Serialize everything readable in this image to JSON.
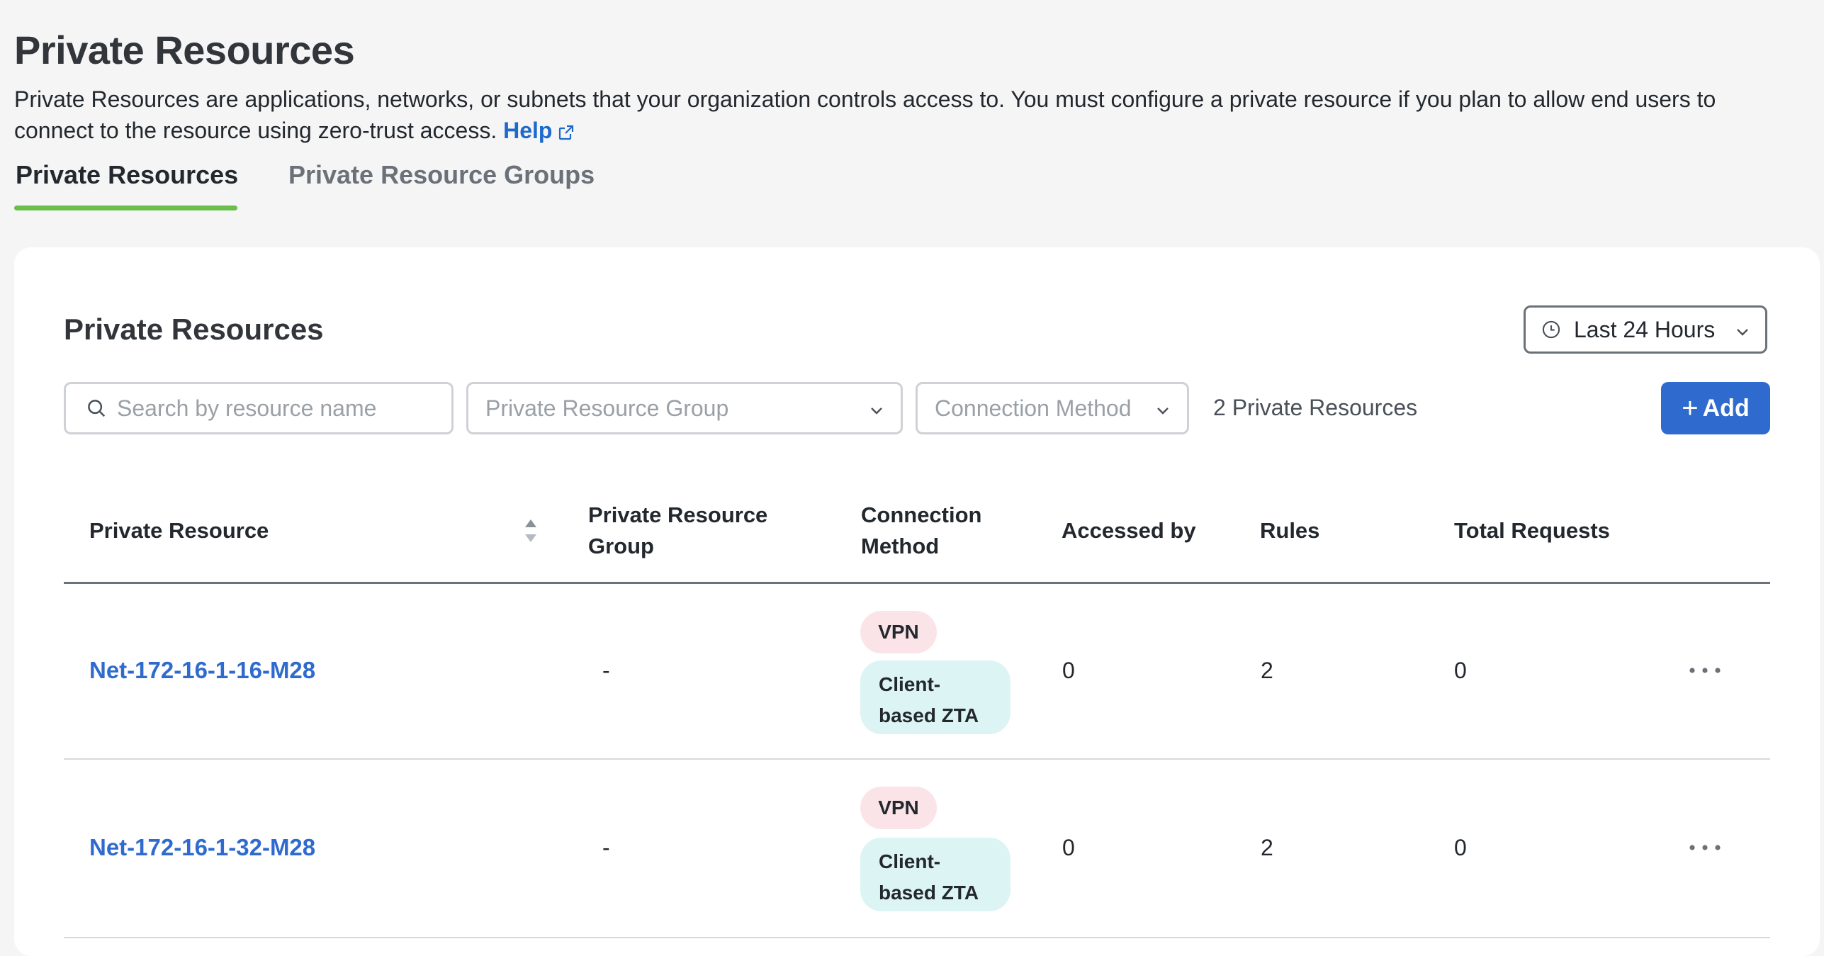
{
  "page": {
    "title": "Private Resources",
    "description": "Private Resources are applications, networks, or subnets that your organization controls access to. You must configure a private resource if you plan to allow end users to connect to the resource using zero-trust access.",
    "help_label": "Help"
  },
  "tabs": [
    {
      "label": "Private Resources",
      "active": true
    },
    {
      "label": "Private Resource Groups",
      "active": false
    }
  ],
  "card": {
    "title": "Private Resources",
    "time_range": "Last 24 Hours",
    "search_placeholder": "Search by resource name",
    "group_filter_placeholder": "Private Resource Group",
    "connection_filter_placeholder": "Connection Method",
    "count_label": "2 Private Resources",
    "add_label": "Add"
  },
  "table": {
    "headers": {
      "resource": "Private Resource",
      "group_line1": "Private Resource",
      "group_line2": "Group",
      "connection_line1": "Connection",
      "connection_line2": "Method",
      "accessed_by": "Accessed by",
      "rules": "Rules",
      "total_requests": "Total Requests"
    },
    "rows": [
      {
        "name": "Net-172-16-1-16-M28",
        "group": "-",
        "methods": {
          "vpn": "VPN",
          "zta_line1": "Client-",
          "zta_line2": "based ZTA"
        },
        "accessed_by": "0",
        "rules": "2",
        "total_requests": "0"
      },
      {
        "name": "Net-172-16-1-32-M28",
        "group": "-",
        "methods": {
          "vpn": "VPN",
          "zta_line1": "Client-",
          "zta_line2": "based ZTA"
        },
        "accessed_by": "0",
        "rules": "2",
        "total_requests": "0"
      }
    ]
  },
  "colors": {
    "accent": "#2f6bce",
    "tab_underline": "#6abf4b",
    "vpn_pill": "#fbe4e8",
    "zta_pill": "#dcf4f4"
  },
  "icons": [
    "external-link-icon",
    "clock-icon",
    "chevron-down-icon",
    "search-icon",
    "sort-icon",
    "more-icon"
  ]
}
